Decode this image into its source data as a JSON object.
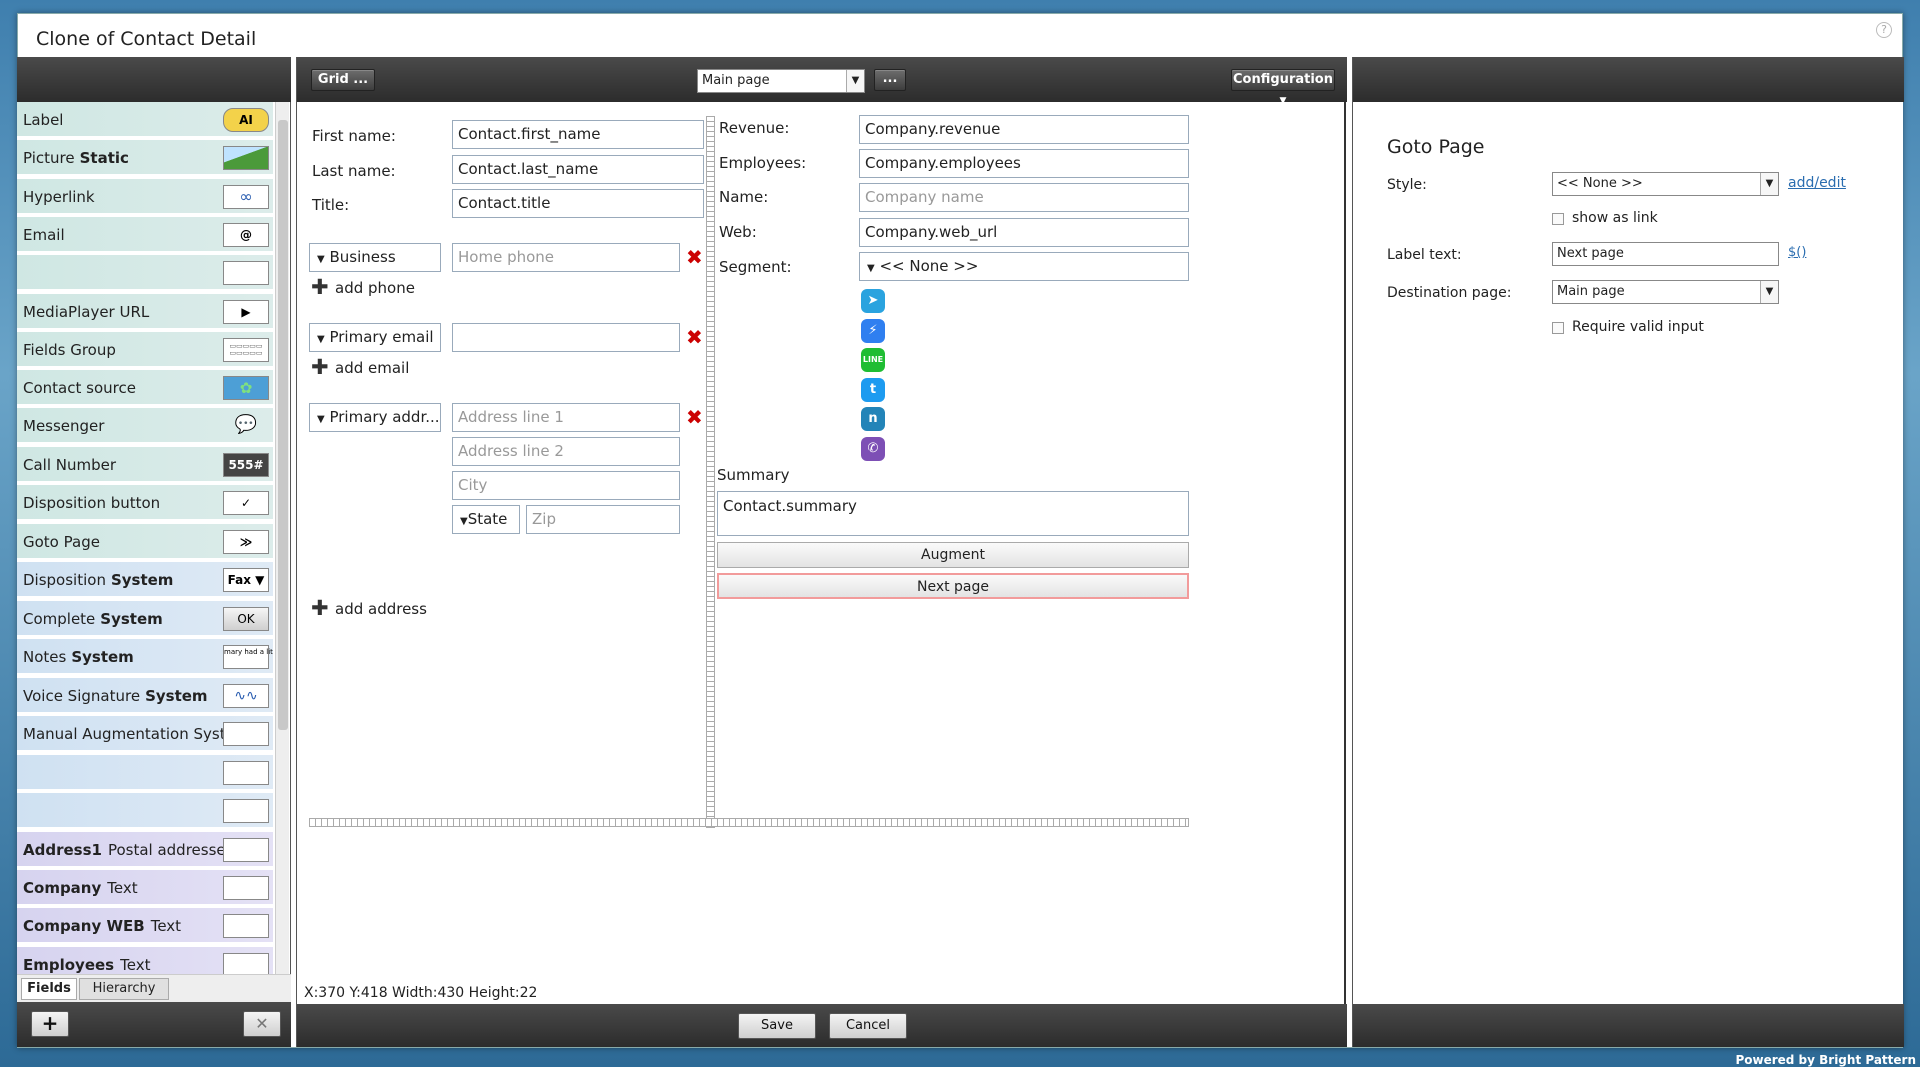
{
  "window": {
    "title": "Clone of Contact Detail",
    "help": "?"
  },
  "sidebar": {
    "items": [
      {
        "label": "Label",
        "bold": "",
        "icon": "AI"
      },
      {
        "label": "Picture",
        "bold": "Static",
        "icon": "picture-icon"
      },
      {
        "label": "Hyperlink",
        "bold": "",
        "icon": "link-icon"
      },
      {
        "label": "Email",
        "bold": "",
        "icon": "@"
      },
      {
        "label": "",
        "bold": "",
        "icon": ""
      },
      {
        "label": "MediaPlayer URL",
        "bold": "",
        "icon": "▶"
      },
      {
        "label": "Fields Group",
        "bold": "",
        "icon": "fields-group-icon"
      },
      {
        "label": "Contact source",
        "bold": "",
        "icon": "contact-source-icon"
      },
      {
        "label": "Messenger",
        "bold": "",
        "icon": "speech-bubble-icon"
      },
      {
        "label": "Call Number",
        "bold": "",
        "icon": "555#"
      },
      {
        "label": "Disposition button",
        "bold": "",
        "icon": "✓"
      },
      {
        "label": "Goto Page",
        "bold": "",
        "icon": "≫"
      },
      {
        "label": "Disposition",
        "bold": "System",
        "icon": "Fax ▼"
      },
      {
        "label": "Complete",
        "bold": "System",
        "icon": "OK"
      },
      {
        "label": "Notes",
        "bold": "System",
        "icon": "mary had a little lamb"
      },
      {
        "label": "Voice Signature",
        "bold": "System",
        "icon": "waveform-icon"
      },
      {
        "label": "Manual Augmentation Syst...",
        "bold": "",
        "icon": ""
      },
      {
        "label": "",
        "bold": "",
        "icon": ""
      },
      {
        "label": "",
        "bold": "",
        "icon": ""
      },
      {
        "label": "Postal addresses",
        "bold": "Address1",
        "icon": ""
      },
      {
        "label": "Text",
        "bold": "Company",
        "icon": ""
      },
      {
        "label": "Text",
        "bold": "Company WEB",
        "icon": ""
      },
      {
        "label": "Text",
        "bold": "Employees",
        "icon": ""
      }
    ],
    "tabs": [
      "Fields",
      "Hierarchy"
    ],
    "add_label": "+",
    "remove_label": "✕"
  },
  "toolbar": {
    "grid_label": "Grid ...",
    "page_select": "Main page",
    "more_label": "...",
    "config_label": "Configuration"
  },
  "form": {
    "first_name_label": "First name:",
    "first_name_value": "Contact.first_name",
    "last_name_label": "Last name:",
    "last_name_value": "Contact.last_name",
    "title_label": "Title:",
    "title_value": "Contact.title",
    "phone_type": "Business",
    "phone_placeholder": "Home phone",
    "add_phone": "add phone",
    "email_type": "Primary email",
    "email_value": "",
    "add_email": "add email",
    "address_type": "Primary addr...",
    "address1_placeholder": "Address line 1",
    "address2_placeholder": "Address line 2",
    "city_placeholder": "City",
    "state_label": "State",
    "zip_placeholder": "Zip",
    "add_address": "add address",
    "revenue_label": "Revenue:",
    "revenue_value": "Company.revenue",
    "employees_label": "Employees:",
    "employees_value": "Company.employees",
    "name_label": "Name:",
    "name_placeholder": "Company name",
    "web_label": "Web:",
    "web_value": "Company.web_url",
    "segment_label": "Segment:",
    "segment_value": "<< None >>",
    "summary_label": "Summary",
    "summary_value": "Contact.summary",
    "augment_label": "Augment",
    "next_page_label": "Next page"
  },
  "messengers": [
    {
      "name": "telegram-icon",
      "glyph": "➤",
      "color": "#2aa3df"
    },
    {
      "name": "messenger-icon",
      "glyph": "⚡",
      "color": "#2f7ff0"
    },
    {
      "name": "line-icon",
      "glyph": "LINE",
      "color": "#1fbd33"
    },
    {
      "name": "twitter-icon",
      "glyph": "t",
      "color": "#1d9bf0"
    },
    {
      "name": "nextel-icon",
      "glyph": "n",
      "color": "#2384b8"
    },
    {
      "name": "viber-icon",
      "glyph": "✆",
      "color": "#7d4fb5"
    }
  ],
  "status": {
    "text": "X:370 Y:418 Width:430 Height:22"
  },
  "footer": {
    "save_label": "Save",
    "cancel_label": "Cancel"
  },
  "properties": {
    "heading": "Goto Page",
    "style_label": "Style:",
    "style_value": "<< None >>",
    "add_edit": "add/edit",
    "show_as_link": "show as link",
    "label_text_label": "Label text:",
    "label_text_value": "Next page",
    "var_link": "$()",
    "destination_label": "Destination page:",
    "destination_value": "Main page",
    "require_valid": "Require valid input"
  },
  "powered_by": "Powered by Bright Pattern"
}
